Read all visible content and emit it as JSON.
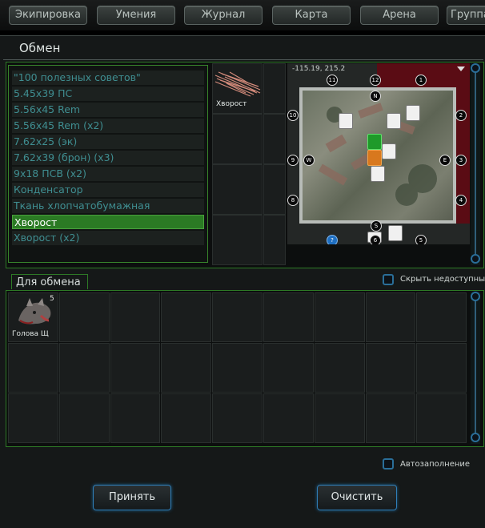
{
  "tabs": [
    "Экипировка",
    "Умения",
    "Журнал",
    "Карта",
    "Арена",
    "Группа"
  ],
  "window": {
    "title": "Обмен"
  },
  "list": {
    "items": [
      "\"100 полезных советов\"",
      "5.45x39 ПС",
      "5.56x45 Rem",
      "5.56x45 Rem (x2)",
      "7.62x25 (эк)",
      "7.62x39 (брон) (x3)",
      "9x18 ПСВ (x2)",
      "Конденсатор",
      "Ткань хлопчатобумажная",
      "Хворост",
      "Хворост (x2)"
    ],
    "selected_index": 9
  },
  "preview": {
    "item_name": "Хворост"
  },
  "map": {
    "coordinates": "-115.19, 215.2",
    "nodes": [
      "11",
      "12",
      "1",
      "10",
      "2",
      "9",
      "3",
      "8",
      "4",
      "?",
      "6",
      "5"
    ],
    "compass": [
      "N",
      "W",
      "E",
      "S"
    ]
  },
  "exchange": {
    "tab_label": "Для обмена",
    "hide_unavailable_label": "Скрыть недоступные",
    "item": {
      "name": "Голова Щ",
      "quantity": "5"
    },
    "autofill_label": "Автозаполнение"
  },
  "buttons": {
    "accept": "Принять",
    "clear": "Очистить"
  },
  "colors": {
    "accent_green": "#2e7a26",
    "selected_green": "#2b7a24",
    "list_text": "#3f8e91",
    "accent_blue": "#2f7eb8"
  }
}
